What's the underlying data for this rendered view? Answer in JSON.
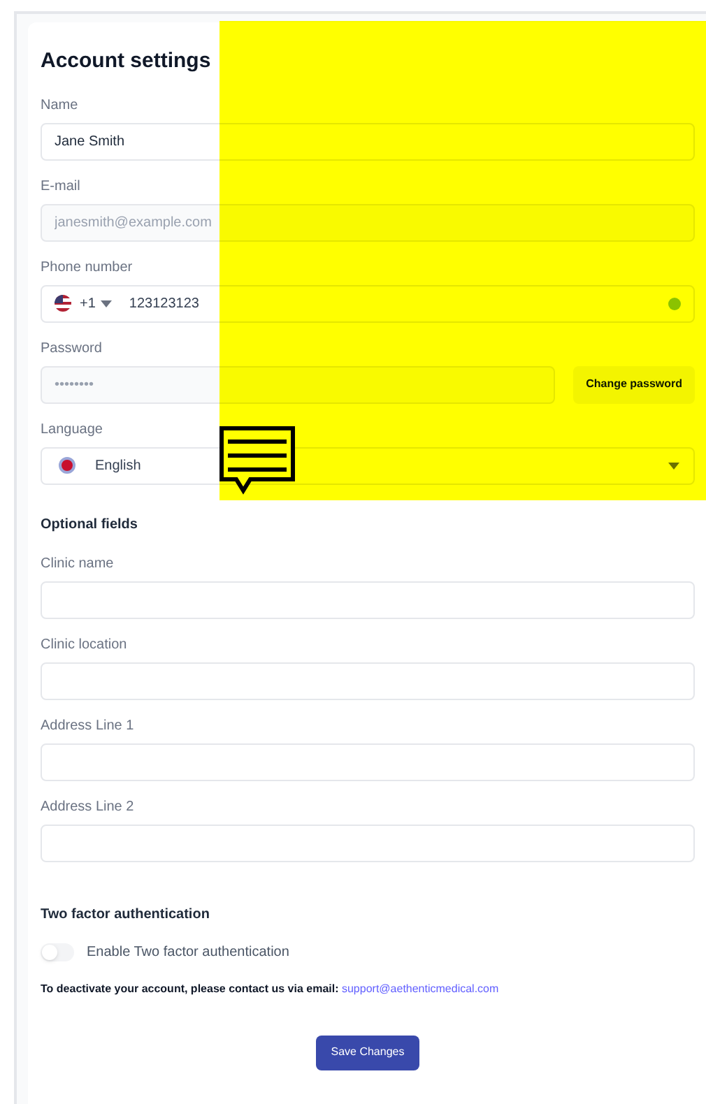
{
  "title": "Account settings",
  "fields": [
    {
      "kind": "text",
      "label": "Name",
      "value": "Jane Smith",
      "disabled": false
    },
    {
      "kind": "text",
      "label": "E-mail",
      "value": "janesmith@example.com",
      "disabled": true
    },
    {
      "kind": "phone",
      "label": "Phone number",
      "dial_code": "+1",
      "value": "123123123",
      "verified": true
    },
    {
      "kind": "password",
      "label": "Password",
      "value": "••••••••",
      "button": "Change password"
    },
    {
      "kind": "select",
      "label": "Language",
      "value": "English"
    }
  ],
  "optional": {
    "heading": "Optional fields",
    "fields": [
      {
        "label": "Clinic name"
      },
      {
        "label": "Clinic location"
      },
      {
        "label": "Address Line 1"
      },
      {
        "label": "Address Line 2"
      }
    ]
  },
  "two_factor": {
    "heading": "Two factor authentication",
    "toggle_label": "Enable Two factor authentication",
    "on": false
  },
  "deactivate": {
    "text": "To deactivate your account, please contact us via email:",
    "email": "support@aethenticmedical.com"
  },
  "save_button": "Save Changes"
}
